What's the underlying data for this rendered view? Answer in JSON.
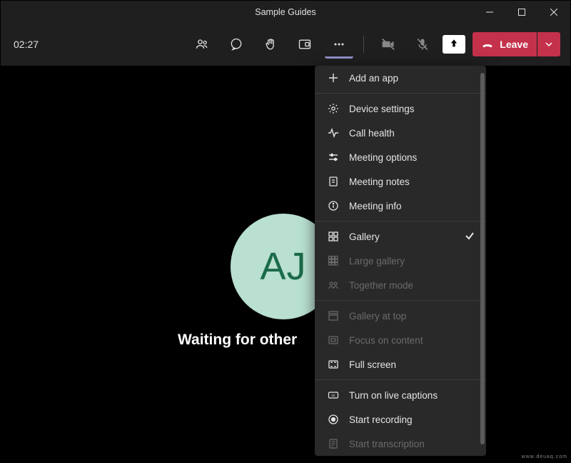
{
  "window": {
    "title": "Sample Guides"
  },
  "toolbar": {
    "timer": "02:27",
    "leave_label": "Leave"
  },
  "stage": {
    "avatar_initials": "AJ",
    "waiting_text": "Waiting for other"
  },
  "menu": {
    "add_app": "Add an app",
    "device_settings": "Device settings",
    "call_health": "Call health",
    "meeting_options": "Meeting options",
    "meeting_notes": "Meeting notes",
    "meeting_info": "Meeting info",
    "gallery": "Gallery",
    "large_gallery": "Large gallery",
    "together_mode": "Together mode",
    "gallery_at_top": "Gallery at top",
    "focus_on_content": "Focus on content",
    "full_screen": "Full screen",
    "live_captions": "Turn on live captions",
    "start_recording": "Start recording",
    "start_transcription": "Start transcription"
  },
  "watermark": "www.deuaq.com"
}
